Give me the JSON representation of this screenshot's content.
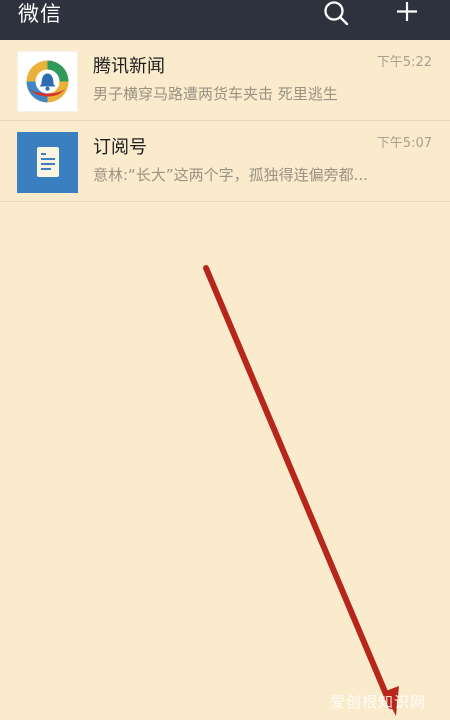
{
  "header": {
    "title": "微信",
    "search_icon": "search-icon",
    "add_icon": "plus-icon"
  },
  "chats": [
    {
      "name": "腾讯新闻",
      "preview": "男子横穿马路遭两货车夹击 死里逃生",
      "time": "下午5:22",
      "avatar_icon": "tencent-news-logo"
    },
    {
      "name": "订阅号",
      "preview": "意林:“长大”这两个字，孤独得连偏旁都...",
      "time": "下午5:07",
      "avatar_icon": "subscription-icon"
    }
  ],
  "watermark": "爱创根知识网",
  "colors": {
    "header_bg": "#2d323e",
    "page_bg": "#f9ebcc",
    "subscription_blue": "#3a80c0",
    "annotation_red": "#b7261a"
  }
}
